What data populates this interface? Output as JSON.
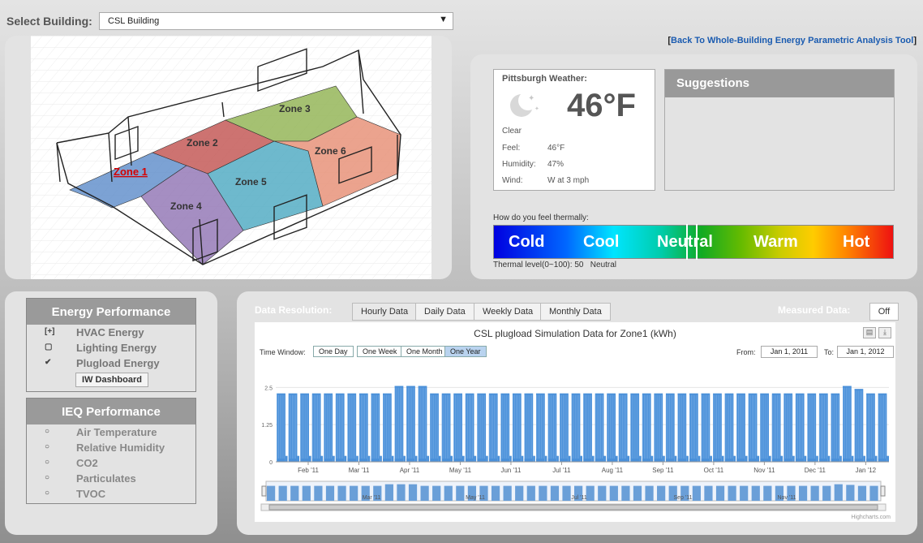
{
  "header": {
    "select_label": "Select Building:",
    "building_value": "CSL Building",
    "back_link_prefix": "[",
    "back_link": "Back To Whole-Building Energy Parametric Analysis Tool",
    "back_link_suffix": "]"
  },
  "model": {
    "zones": [
      "Zone 1",
      "Zone 2",
      "Zone 3",
      "Zone 4",
      "Zone 5",
      "Zone 6"
    ],
    "zone_colors": [
      "#5b8bc9",
      "#c0504d",
      "#8fb24f",
      "#8e72b3",
      "#4aa8c0",
      "#e68c72"
    ]
  },
  "weather": {
    "title": "Pittsburgh Weather:",
    "icon": "moon-stars-icon",
    "temperature": "46°F",
    "condition": "Clear",
    "feel_label": "Feel:",
    "feel_value": "46°F",
    "humidity_label": "Humidity:",
    "humidity_value": "47%",
    "wind_label": "Wind:",
    "wind_value": "W at 3 mph"
  },
  "suggestions": {
    "title": "Suggestions"
  },
  "thermal": {
    "question": "How do you feel thermally:",
    "labels": [
      "Cold",
      "Cool",
      "Neutral",
      "Warm",
      "Hot"
    ],
    "level_text": "Thermal level(0~100): 50",
    "level_state": "Neutral",
    "level_value": 50
  },
  "energy": {
    "title": "Energy Performance",
    "items": [
      {
        "marker": "[+]",
        "label": "HVAC Energy"
      },
      {
        "marker": "▢",
        "label": "Lighting Energy"
      },
      {
        "marker": "✔",
        "label": "Plugload Energy"
      }
    ],
    "dashboard_button": "IW Dashboard"
  },
  "ieq": {
    "title": "IEQ Performance",
    "items": [
      {
        "marker": "○",
        "label": "Air Temperature"
      },
      {
        "marker": "○",
        "label": "Relative Humidity"
      },
      {
        "marker": "○",
        "label": "CO2"
      },
      {
        "marker": "○",
        "label": "Particulates"
      },
      {
        "marker": "○",
        "label": "TVOC"
      }
    ]
  },
  "chart_panel": {
    "resolution_label": "Data Resolution:",
    "tabs": [
      "Hourly Data",
      "Daily Data",
      "Weekly Data",
      "Monthly Data"
    ],
    "measured_label": "Measured Data:",
    "measured_value": "Off",
    "time_window_label": "Time Window:",
    "time_buttons": [
      "One Day",
      "One Week",
      "One Month",
      "One Year"
    ],
    "from_label": "From:",
    "from_value": "Jan 1, 2011",
    "to_label": "To:",
    "to_value": "Jan 1, 2012",
    "credit": "Highcharts.com"
  },
  "chart_data": {
    "type": "area",
    "title": "CSL plugload Simulation Data for Zone1 (kWh)",
    "color": "#4a90d9",
    "y_ticks": [
      "0",
      "1.25",
      "2.5"
    ],
    "ylim": [
      0,
      3
    ],
    "x_ticks": [
      "Feb '11",
      "Mar '11",
      "Apr '11",
      "May '11",
      "Jun '11",
      "Jul '11",
      "Aug '11",
      "Sep '11",
      "Oct '11",
      "Nov '11",
      "Dec '11",
      "Jan '12"
    ],
    "nav_ticks": [
      "Mar '11",
      "May '11",
      "Jul '11",
      "Sep '11",
      "Nov '11"
    ],
    "weekly_peak_kwh": 2.3,
    "weekly_baseline_kwh": 0.2,
    "peak_weeks_kwh": {
      "10": 2.55,
      "11": 2.55,
      "12": 2.55,
      "48": 2.55,
      "49": 2.45
    },
    "weeks": 52
  }
}
